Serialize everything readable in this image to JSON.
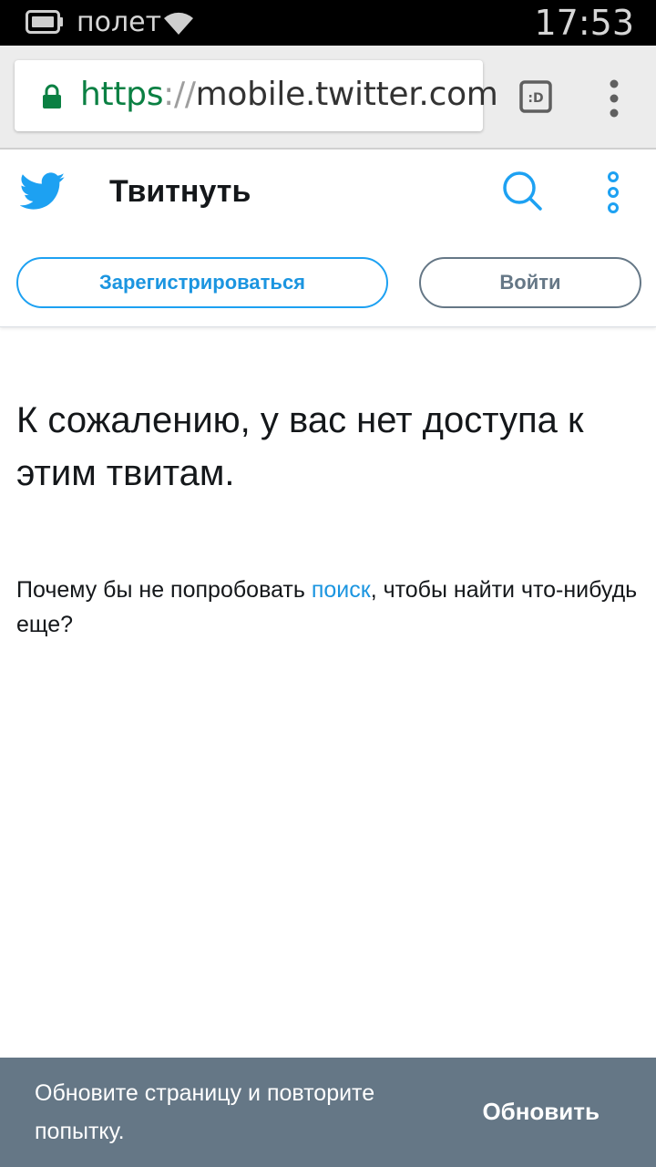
{
  "status_bar": {
    "carrier": "полет",
    "time": "17:53",
    "icons": [
      "battery-icon",
      "wifi-icon"
    ]
  },
  "browser": {
    "url_scheme": "https",
    "url_separator": "://",
    "url_host": "mobile.twitter.com",
    "tabs_icon_label": ":D",
    "icons": [
      "lock-icon",
      "tabs-icon",
      "menu-dots-icon"
    ]
  },
  "twitter_header": {
    "title": "Твитнуть",
    "signup_label": "Зарегистрироваться",
    "login_label": "Войти",
    "icons": [
      "twitter-bird-icon",
      "search-icon",
      "more-icon"
    ]
  },
  "main": {
    "headline": "К сожалению, у вас нет доступа к этим твитам.",
    "subtext_before": "Почему бы не попробовать ",
    "subtext_link": "поиск",
    "subtext_after": ", чтобы найти что-нибудь еще?"
  },
  "snackbar": {
    "message": "Обновите страницу и повторите попытку.",
    "action_label": "Обновить"
  },
  "colors": {
    "twitter_blue": "#1da1f2",
    "link_blue": "#1b95e0",
    "secure_green": "#0b8043",
    "snackbar_bg": "#657786"
  }
}
